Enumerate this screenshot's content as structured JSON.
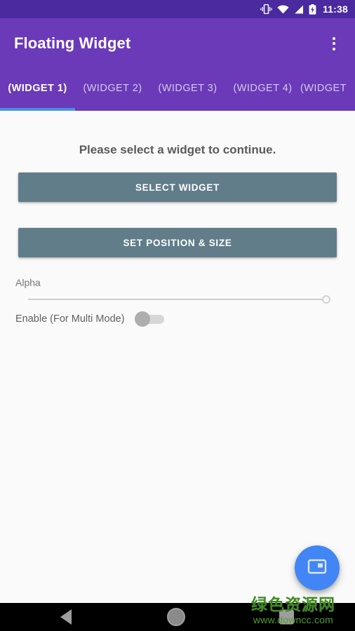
{
  "status_bar": {
    "time": "11:38",
    "icons": [
      "vibrate-icon",
      "wifi-icon",
      "signal-icon",
      "battery-charging-icon"
    ],
    "background": "#4a2a9e"
  },
  "app_bar": {
    "title": "Floating Widget",
    "overflow_icon": "overflow-menu-icon",
    "background": "#6a3ab8"
  },
  "tabs": {
    "active_index": 0,
    "indicator_color": "#4a90e2",
    "items": [
      {
        "label": "(WIDGET 1)"
      },
      {
        "label": "(WIDGET 2)"
      },
      {
        "label": "(WIDGET 3)"
      },
      {
        "label": "(WIDGET 4)"
      },
      {
        "label": "(WIDGET"
      }
    ]
  },
  "content": {
    "headline": "Please select a widget to continue.",
    "select_widget_label": "SELECT WIDGET",
    "set_position_label": "SET POSITION & SIZE",
    "button_color": "#617d8a",
    "alpha": {
      "label": "Alpha",
      "value": 100,
      "min": 0,
      "max": 100
    },
    "multi_mode": {
      "label": "Enable (For Multi Mode)",
      "checked": false
    }
  },
  "fab": {
    "icon": "picture-in-picture-icon",
    "color": "#4285f4"
  },
  "watermark": {
    "site_name": "绿色资源网",
    "url": "www.downcc.com",
    "color": "#3d8a1f"
  },
  "nav_bar": {
    "back_icon": "back-triangle-icon",
    "home_icon": "home-circle-icon",
    "recents_icon": "recents-square-icon"
  }
}
